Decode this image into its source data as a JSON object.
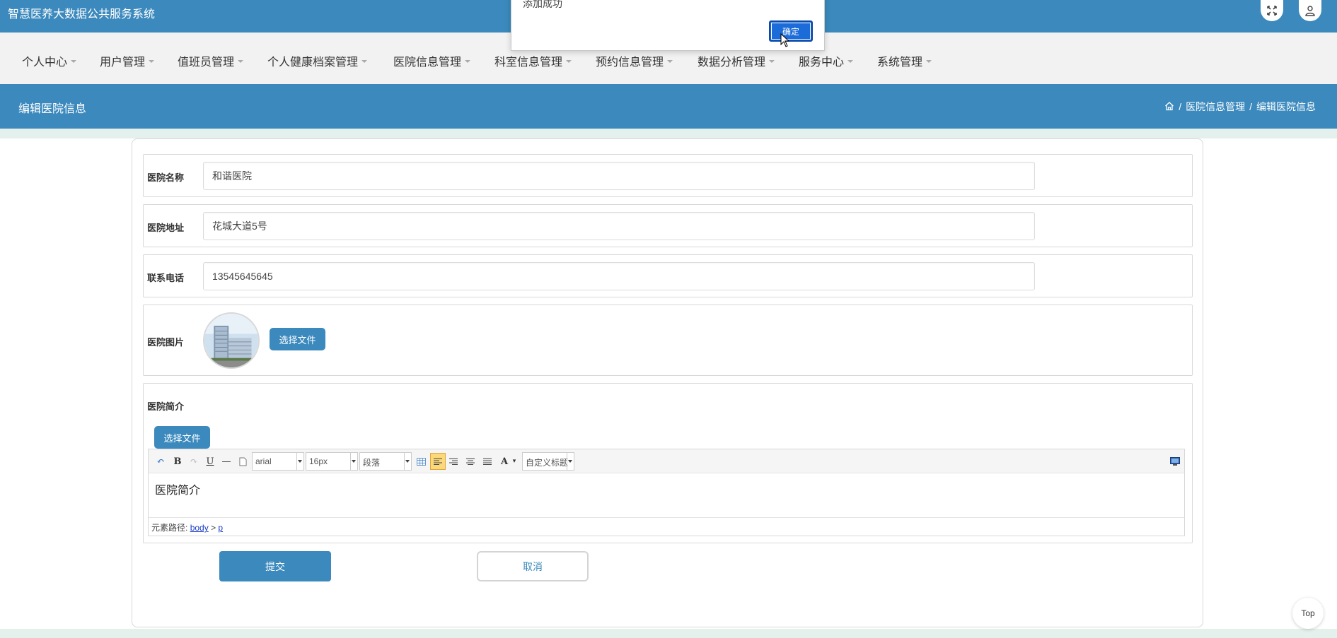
{
  "app": {
    "title": "智慧医养大数据公共服务系统"
  },
  "top_icons": [
    {
      "name": "fullscreen-icon"
    },
    {
      "name": "user-icon"
    }
  ],
  "nav": {
    "items": [
      {
        "label": "个人中心"
      },
      {
        "label": "用户管理"
      },
      {
        "label": "值班员管理"
      },
      {
        "label": "个人健康档案管理"
      },
      {
        "label": "医院信息管理"
      },
      {
        "label": "科室信息管理"
      },
      {
        "label": "预约信息管理"
      },
      {
        "label": "数据分析管理"
      },
      {
        "label": "服务中心"
      },
      {
        "label": "系统管理"
      }
    ]
  },
  "header": {
    "title": "编辑医院信息",
    "breadcrumb": {
      "sep": "/",
      "section": "医院信息管理",
      "current": "编辑医院信息"
    }
  },
  "form": {
    "name": {
      "label": "医院名称",
      "value": "和谐医院"
    },
    "address": {
      "label": "医院地址",
      "value": "花城大道5号"
    },
    "phone": {
      "label": "联系电话",
      "value": "13545645645"
    },
    "image": {
      "label": "医院图片",
      "button": "选择文件"
    },
    "intro": {
      "label": "医院简介",
      "button": "选择文件",
      "editor": {
        "font": "arial",
        "size": "16px",
        "paragraph": "段落",
        "custom_title": "自定义标题",
        "content": "医院简介",
        "path_label": "元素路径:",
        "path_body": "body",
        "path_gt": ">",
        "path_p": "p"
      }
    },
    "submit": "提交",
    "cancel": "取消"
  },
  "dialog": {
    "message": "添加成功",
    "ok": "确定"
  },
  "top_button": "Top",
  "colors": {
    "primary": "#3b89bd",
    "nav_bg": "#f2f2f2",
    "strip": "#e4f0ec",
    "dialog_ok": "#1b6bd8"
  }
}
